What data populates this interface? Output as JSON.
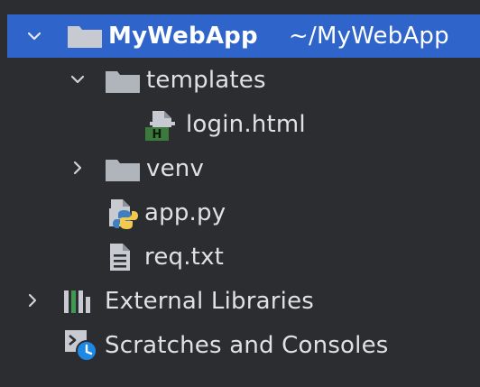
{
  "project": {
    "name": "MyWebApp",
    "path": "~/MyWebApp"
  },
  "tree": {
    "templates": "templates",
    "login": "login.html",
    "venv": "venv",
    "app": "app.py",
    "req": "req.txt",
    "external": "External Libraries",
    "scratches": "Scratches and Consoles"
  },
  "icons": {
    "folder": "folder-icon",
    "html_file": "html-file-icon",
    "python_file": "python-file-icon",
    "text_file": "text-file-icon",
    "libraries": "libraries-icon",
    "scratches": "scratches-icon"
  },
  "colors": {
    "background": "#2b2d30",
    "selection": "#2f65ca",
    "folder": "#b0b4bb",
    "html_badge": "#3b7a3a",
    "python_blue": "#3e7fc1",
    "python_yellow": "#f2c94c",
    "scratch_badge": "#1e88e5"
  }
}
